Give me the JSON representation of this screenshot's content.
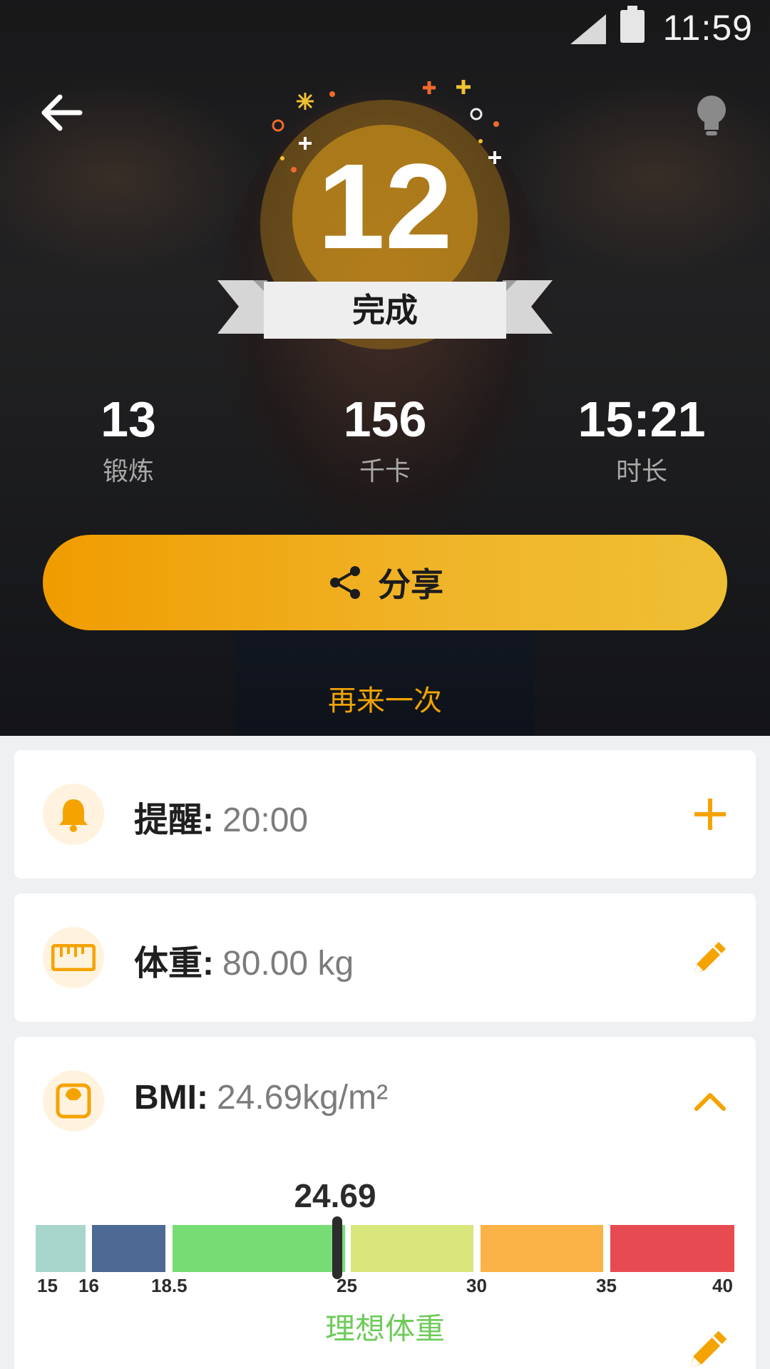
{
  "status_bar": {
    "time": "11:59"
  },
  "header": {
    "completed_count": "12",
    "completed_label": "完成"
  },
  "stats": [
    {
      "value": "13",
      "label": "锻炼"
    },
    {
      "value": "156",
      "label": "千卡"
    },
    {
      "value": "15:21",
      "label": "时长"
    }
  ],
  "actions": {
    "share_label": "分享",
    "again_label": "再来一次"
  },
  "reminder": {
    "label": "提醒:",
    "value": "20:00"
  },
  "weight": {
    "label": "体重:",
    "value": "80.00 kg"
  },
  "bmi": {
    "label": "BMI:",
    "value": "24.69kg/m²",
    "indicator_value": "24.69",
    "ticks": [
      "15",
      "16",
      "18.5",
      "25",
      "30",
      "35",
      "40"
    ],
    "status": "理想体重",
    "segment_colors": [
      "#a9d6cc",
      "#4d6a95",
      "#78dc75",
      "#d8e67c",
      "#fbb347",
      "#e74b52"
    ]
  },
  "colors": {
    "accent": "#f0a300",
    "ideal_green": "#6ecb5a"
  }
}
